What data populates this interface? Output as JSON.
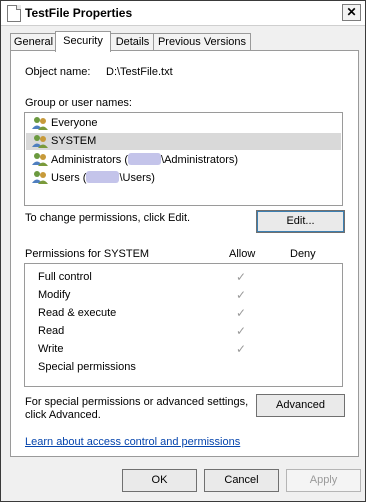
{
  "window": {
    "title": "TestFile Properties",
    "close_label": "✕"
  },
  "tabs": [
    {
      "label": "General"
    },
    {
      "label": "Security"
    },
    {
      "label": "Details"
    },
    {
      "label": "Previous Versions"
    }
  ],
  "security": {
    "object_name_label": "Object name:",
    "object_name_value": "D:\\TestFile.txt",
    "groups_label": "Group or user names:",
    "users": [
      {
        "prefix": "Everyone",
        "suffix": "",
        "redacted": false,
        "icon": "users-group-icon"
      },
      {
        "prefix": "SYSTEM",
        "suffix": "",
        "redacted": false,
        "icon": "users-group-icon"
      },
      {
        "prefix": "Administrators (",
        "suffix": "\\Administrators)",
        "redacted": true,
        "icon": "users-group-icon"
      },
      {
        "prefix": "Users (",
        "suffix": "\\Users)",
        "redacted": true,
        "icon": "users-group-icon"
      }
    ],
    "selected_user_index": 1,
    "change_hint": "To change permissions, click Edit.",
    "edit_button": "Edit...",
    "permissions_header": "Permissions for SYSTEM",
    "allow_header": "Allow",
    "deny_header": "Deny",
    "permissions": [
      {
        "name": "Full control",
        "allow": "✓"
      },
      {
        "name": "Modify",
        "allow": "✓"
      },
      {
        "name": "Read & execute",
        "allow": "✓"
      },
      {
        "name": "Read",
        "allow": "✓"
      },
      {
        "name": "Write",
        "allow": "✓"
      },
      {
        "name": "Special permissions",
        "allow": ""
      }
    ],
    "advanced_hint": "For special permissions or advanced settings, click Advanced.",
    "advanced_button": "Advanced",
    "learn_link": "Learn about access control and permissions"
  },
  "footer": {
    "ok": "OK",
    "cancel": "Cancel",
    "apply": "Apply"
  },
  "colors": {
    "selection": "#d9d9d9",
    "link": "#0645ad",
    "redaction": "#c4c4ea"
  }
}
